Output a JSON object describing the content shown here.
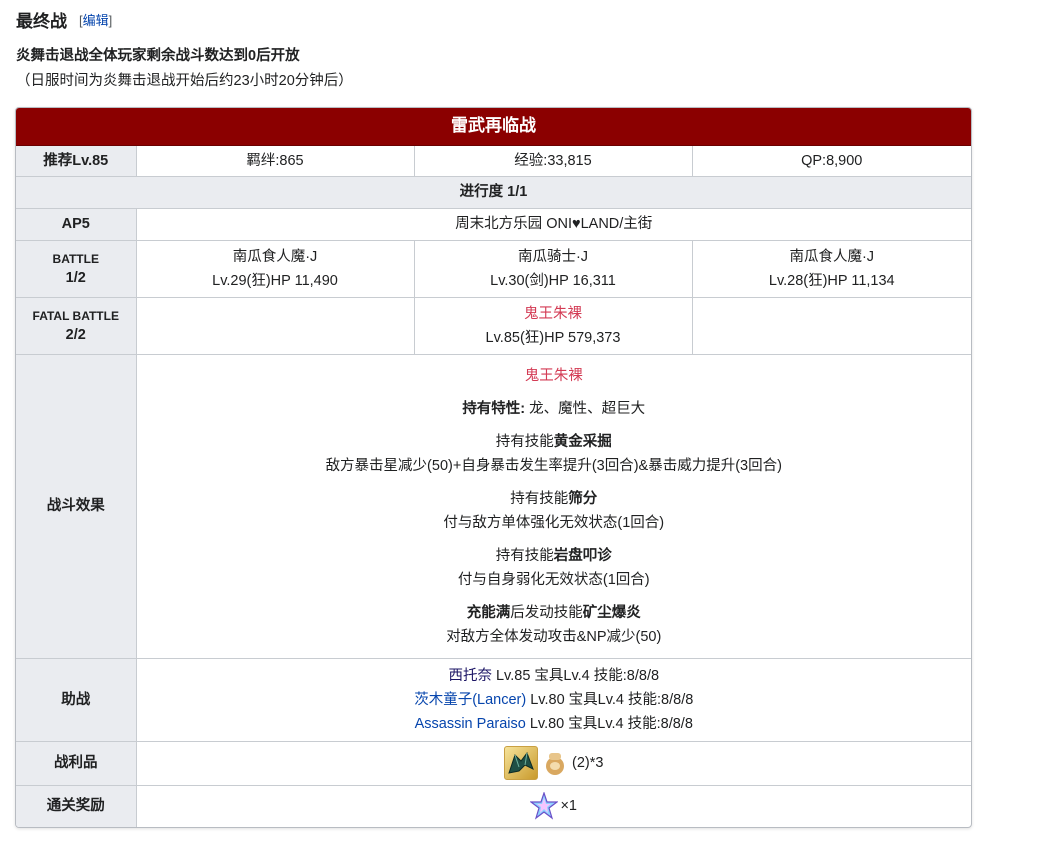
{
  "section": {
    "title": "最终战",
    "edit_bracket_open": "[",
    "edit_label": "编辑",
    "edit_bracket_close": "]"
  },
  "notes": {
    "line1": "炎舞击退战全体玩家剩余战斗数达到0后开放",
    "line2": "（日服时间为炎舞击退战开始后约23小时20分钟后）"
  },
  "quest": {
    "name": "雷武再临战",
    "recommend": "推荐Lv.85",
    "bond": "羁绊:865",
    "exp": "经验:33,815",
    "qp": "QP:8,900",
    "progress": "进行度 1/1",
    "ap": "AP5",
    "location": "周末北方乐园 ONI♥LAND/主街",
    "battle1": {
      "label_top": "BATTLE",
      "label_bottom": "1/2",
      "enemies": [
        {
          "name": "南瓜食人魔·J",
          "stats": "Lv.29(狂)HP 11,490"
        },
        {
          "name": "南瓜骑士·J",
          "stats": "Lv.30(剑)HP 16,311"
        },
        {
          "name": "南瓜食人魔·J",
          "stats": "Lv.28(狂)HP 11,134"
        }
      ]
    },
    "battle2": {
      "label_top": "FATAL BATTLE",
      "label_bottom": "2/2",
      "boss": {
        "name": "鬼王朱裸",
        "stats": "Lv.85(狂)HP 579,373"
      }
    },
    "effects": {
      "label": "战斗效果",
      "boss_name": "鬼王朱裸",
      "traits_label": "持有特性:",
      "traits": " 龙、魔性、超巨大",
      "skills": [
        {
          "prefix": "持有技能",
          "name": "黄金采掘",
          "desc": "敌方暴击星减少(50)+自身暴击发生率提升(3回合)&暴击威力提升(3回合)"
        },
        {
          "prefix": "持有技能",
          "name": "筛分",
          "desc": "付与敌方单体强化无效状态(1回合)"
        },
        {
          "prefix": "持有技能",
          "name": "岩盘叩诊",
          "desc": "付与自身弱化无效状态(1回合)"
        }
      ],
      "np": {
        "cond": "充能满",
        "mid": "后发动技能",
        "name": "矿尘爆炎",
        "desc": "对敌方全体发动攻击&NP减少(50)"
      }
    },
    "support": {
      "label": "助战",
      "rows": [
        {
          "name": "西托奈",
          "detail": " Lv.85 宝具Lv.4 技能:8/8/8"
        },
        {
          "name": "茨木童子(Lancer)",
          "detail": " Lv.80 宝具Lv.4 技能:8/8/8"
        },
        {
          "name": "Assassin Paraiso",
          "detail": " Lv.80 宝具Lv.4 技能:8/8/8"
        }
      ]
    },
    "drops": {
      "label": "战利品",
      "icon1": "dragon-wing-item-icon",
      "icon2": "golden-jar-item-icon",
      "count_text": "(2)*3"
    },
    "reward": {
      "label": "通关奖励",
      "icon": "saint-quartz-icon",
      "count_text": "×1"
    }
  },
  "colors": {
    "header_bg": "#8b0000",
    "label_bg": "#eaecf0",
    "boss_name": "#d33b54",
    "link": "#0645ad"
  }
}
